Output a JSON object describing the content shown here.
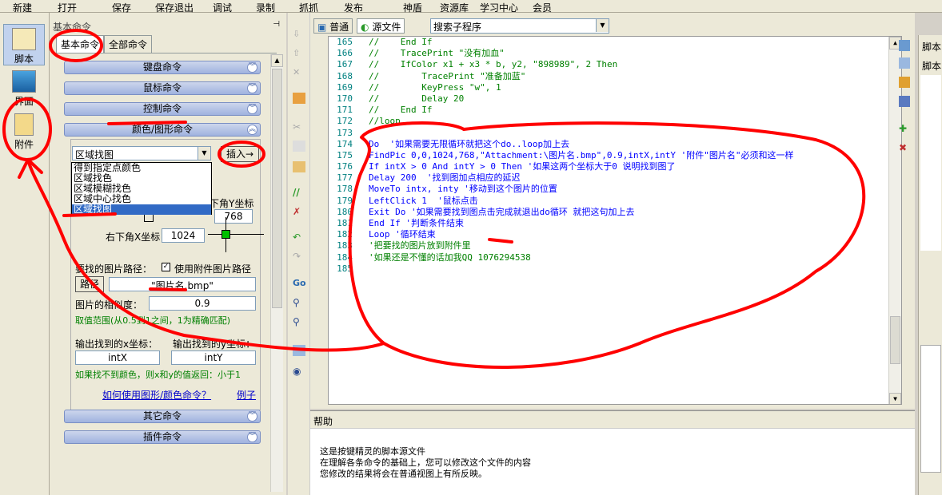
{
  "menu": [
    "新建",
    "打开",
    "保存",
    "保存退出",
    "调试",
    "录制",
    "抓抓",
    "发布",
    "神盾",
    "资源库",
    "学习中心",
    "会员"
  ],
  "leftbar": {
    "items": [
      {
        "label": "脚本"
      },
      {
        "label": "界面"
      },
      {
        "label": "附件"
      }
    ]
  },
  "panel": {
    "title": "基本命令",
    "tab_basic": "基本命令",
    "tab_all": "全部命令",
    "cat_keyboard": "键盘命令",
    "cat_mouse": "鼠标命令",
    "cat_control": "控制命令",
    "cat_color": "颜色/图形命令",
    "cat_other": "其它命令",
    "cat_plugin": "插件命令",
    "combo_value": "区域找图",
    "insert_btn": "插入→",
    "list_items": [
      "得到指定点颜色",
      "区域找色",
      "区域模糊找色",
      "区域中心找色",
      "区域找图"
    ],
    "lr_y_label": "下角Y坐标",
    "lr_y_value": "768",
    "lr_x_label": "右下角X坐标",
    "lr_x_value": "1024",
    "path_label": "要找的图片路径：",
    "use_attach_label": "使用附件图片路径",
    "path_btn": "路径",
    "path_value": "\"图片名.bmp\"",
    "similarity_label": "图片的相似度：",
    "similarity_value": "0.9",
    "similarity_hint": "取值范围(从0.5到1之间，1为精确匹配)",
    "outx_label": "输出找到的x坐标：",
    "outy_label": "输出找到的y坐标：",
    "outx_value": "intX",
    "outy_value": "intY",
    "notfound_hint": "如果找不到颜色，则x和y的值返回：小于1",
    "howto_link": "如何使用图形/颜色命令？",
    "example_link": "例子"
  },
  "editor": {
    "tab_normal": "普通",
    "tab_source": "源文件",
    "search_placeholder": "搜索子程序",
    "line_numbers": [
      "165",
      "166",
      "167",
      "168",
      "169",
      "170",
      "171",
      "172",
      "173",
      "174",
      "175",
      "176",
      "177",
      "178",
      "179",
      "180",
      "181",
      "182",
      "183",
      "184",
      "185"
    ],
    "lines": [
      "//    End If",
      "//    TracePrint \"没有加血\"",
      "//    IfColor x1 + x3 * b, y2, \"898989\", 2 Then",
      "//        TracePrint \"准备加蓝\"",
      "//        KeyPress \"w\", 1",
      "//        Delay 20",
      "//    End If",
      "//loop",
      "",
      "Do  '如果需要无限循环就把这个do..loop加上去",
      "FindPic 0,0,1024,768,\"Attachment:\\图片名.bmp\",0.9,intX,intY '附件\"图片名\"必须和这一样",
      "If intX > 0 And intY > 0 Then '如果这两个坐标大于0 说明找到图了",
      "Delay 200  '找到图加点相应的延迟",
      "MoveTo intx, inty '移动到这个图片的位置",
      "LeftClick 1  '鼠标点击",
      "Exit Do '如果需要找到图点击完成就退出do循环 就把这句加上去",
      "End If '判断条件结束",
      "Loop '循环结束",
      "'把要找的图片放到附件里",
      "'如果还是不懂的话加我QQ 1076294538",
      ""
    ]
  },
  "help": {
    "title": "帮助",
    "lines": [
      "这是按键精灵的脚本源文件",
      "在理解各条命令的基础上，您可以修改这个文件的内容",
      "您修改的结果将会在普通视图上有所反映。"
    ]
  },
  "rightpanel": {
    "title": "脚本",
    "subtitle": "脚本"
  }
}
